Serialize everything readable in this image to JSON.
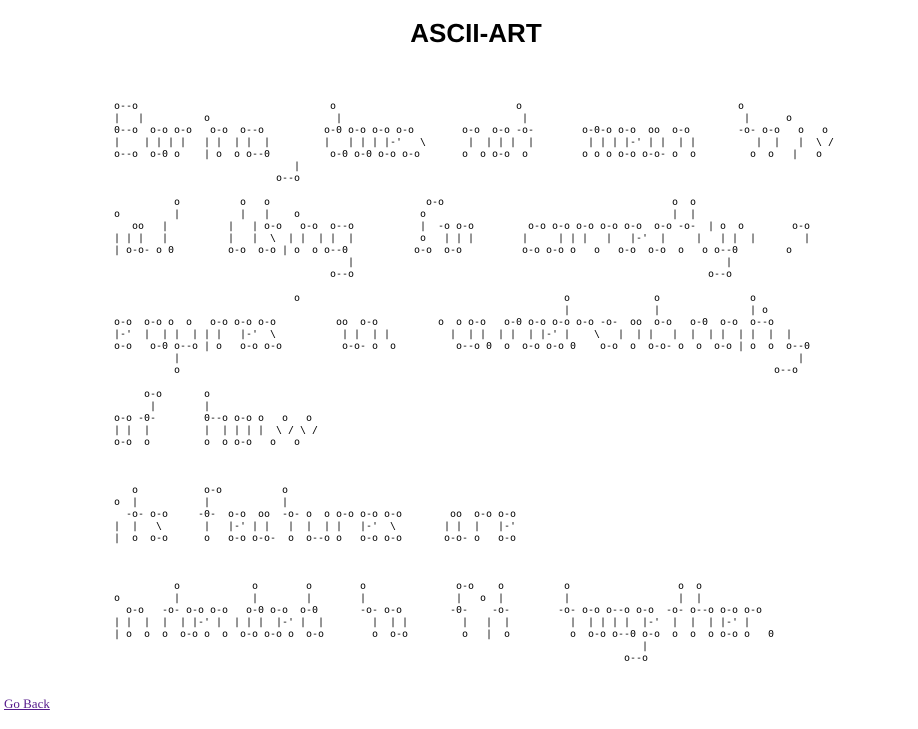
{
  "page_title": "ASCII-ART",
  "back_link_label": "Go Back",
  "ascii_art_lines": [
    "o--o                                o                              o                                    o\n|   |          o                     |                              |                                    |      o\n0--o  o-o o-o   o-o  o--o          o-0 o-o o-o o-o        o-o  o-o -o-        o-0-o o-o  oo  o-o        -o- o-o   o   o\n|    | | | |   | |  | |  |         |   | | | |-'   \\       |  | | |  |         | | | |-' | |  | |          |  |   |  \\ /\no--o  o-0 o    | o  o o--0          o-0 o-0 o-o o-o       o  o o-o  o         o o o o-o o-o- o  o         o  o   |   o\n                              |\n                           o--o",
    "          o          o   o                          o-o                                      o  o\no         |          |   |    o                    o                                         |  |\n   oo   |          |   | o-o   o-o  o--o           |  -o o-o         o-o o-o o-o o-o o-o  o-o -o-  | o  o        o-o\n| | |   |          |   |  \\  | |  | |  |           o   | | |        |     | | |   |   |-'  |     |   | |  |        |\n| o-o- o 0         o-o  o-o | o  o o--0           o-o  o-o          o-o o-o o   o   o-o  o-o  o   o o--0        o\n                                       |                                                              |\n                                    o--o                                                           o--o",
    "                              o                                            o              o               o\n                                                                           |              |               | o\no-o  o-o o  o   o-o o-o o-o          oo  o-o          o  o o-o   o-0 o-o o-o o-o -o-  oo  o-o   o-0  o-o  o--o\n|-'  |  | |  | | |   |-'  \\           | |  | |          |  | |  | |  | |-' |    \\   |  | |   |  |  | |  | |  |  |\no-o   o-0 o--o | o   o-o o-o          o-o- o  o          o--o 0  o  o-o o-o 0    o-o  o  o-o- o  o  o-o | o  o  o--0\n          |                                                                                                       |\n          o                                                                                                   o--o",
    "     o-o       o\n      |        |\no-o -0-        0--o o-o o   o   o\n| |  |         |  | | | |  \\ / \\ /\no-o  o         o  o o-o   o   o",
    "   o           o-o          o\no  |           |            |\n  -o- o-o     -0-  o-o  oo  -o- o  o o-o o-o o-o        oo  o-o o-o\n|  |   \\       |   |-' | |   |  |  | |   |-'  \\        | |  |   |-'\n|  o  o-o      o   o-o o-o-  o  o--o o   o-o o-o       o-o- o   o-o",
    "          o            o        o        o               o-o    o          o                  o  o\no         |            |        |        |               |   o  |          |                  |  |\n  o-o   -o- o-o o-o   o-0 o-o  o-0       -o- o-o        -0-    -o-        -o- o-o o--o o-o  -o- o--o o-o o-o\n| |  |  |  | |-' |  | | |  |-' |  |        |  | |         |   |  |          |  | | | |  |-'  |  |  | |-' |\n| o  o  o  o-o o  o  o-o o-o o  o-o        o  o-o         o   |  o          o  o-o o--0 o-o  o  o  o o-o o   0\n                                                                                        |\n                                                                                     o--o"
  ]
}
